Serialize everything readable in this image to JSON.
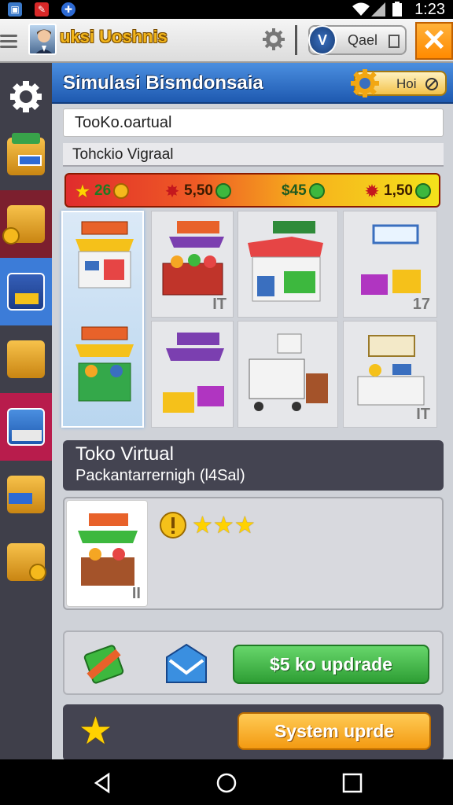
{
  "status_bar": {
    "time": "1:23"
  },
  "app_bar": {
    "title": "uksi Uoshnis",
    "search_text": "Qael",
    "search_badge": "V",
    "close_symbol": "✕"
  },
  "header": {
    "title": "Simulasi Bismdonsaia",
    "pill_text": "Hoi"
  },
  "fields": {
    "field1": "TooKo.oartual",
    "field2": "Tohckio Vigraal"
  },
  "stats": [
    {
      "icon": "star-icon",
      "value": "26"
    },
    {
      "icon": "burst-icon",
      "value": "5,50"
    },
    {
      "icon": "currency-icon",
      "value": "$45"
    },
    {
      "icon": "gift-icon",
      "value": "1,50"
    }
  ],
  "grid": {
    "cells": [
      {
        "name": "stall-1",
        "num": ""
      },
      {
        "name": "stall-2",
        "num": "IT"
      },
      {
        "name": "stall-3",
        "num": ""
      },
      {
        "name": "stall-4",
        "num": "17"
      },
      {
        "name": "stall-5",
        "num": ""
      },
      {
        "name": "stall-6",
        "num": ""
      },
      {
        "name": "stall-7",
        "num": ""
      },
      {
        "name": "stall-8",
        "num": "IT"
      }
    ]
  },
  "info": {
    "title": "Toko Virtual",
    "subtitle": "Packantarrernigh (l4Sal)"
  },
  "detail": {
    "thumb_num": "II",
    "stars": 3
  },
  "actions": {
    "upgrade_label": "$5 ko updrade",
    "system_label": "System uprde"
  },
  "colors": {
    "accent_blue": "#1e59b0",
    "green": "#2e9e34",
    "orange": "#f39a12"
  }
}
